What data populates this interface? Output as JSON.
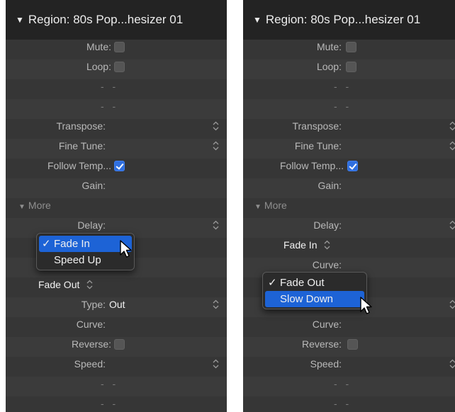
{
  "left": {
    "header": "Region: 80s Pop...hesizer 01",
    "mute": "Mute:",
    "loop": "Loop:",
    "dash1": "- -",
    "dash2": "- -",
    "transpose": "Transpose:",
    "fine_tune": "Fine Tune:",
    "follow_tempo": "Follow Temp...",
    "follow_tempo_checked": true,
    "gain": "Gain:",
    "more": "More",
    "delay": "Delay:",
    "menu": {
      "items": [
        {
          "label": "Fade In",
          "checked": true,
          "highlighted": true
        },
        {
          "label": "Speed Up",
          "checked": false,
          "highlighted": false
        }
      ]
    },
    "check_mark": "✓",
    "fade_out": "Fade Out",
    "type_label": "Type:",
    "type_value": "Out",
    "curve": "Curve:",
    "reverse": "Reverse:",
    "speed": "Speed:",
    "dash3": "- -",
    "dash4": "- -"
  },
  "right": {
    "header": "Region: 80s Pop...hesizer 01",
    "mute": "Mute:",
    "loop": "Loop:",
    "dash1": "- -",
    "dash2": "- -",
    "transpose": "Transpose:",
    "fine_tune": "Fine Tune:",
    "follow_tempo": "Follow Temp...",
    "follow_tempo_checked": true,
    "gain": "Gain:",
    "more": "More",
    "delay": "Delay:",
    "fade_in": "Fade In",
    "curve": "Curve:",
    "menu": {
      "items": [
        {
          "label": "Fade Out",
          "checked": true,
          "highlighted": false
        },
        {
          "label": "Slow Down",
          "checked": false,
          "highlighted": true
        }
      ]
    },
    "check_mark": "✓",
    "curve2": "Curve:",
    "reverse": "Reverse:",
    "speed": "Speed:",
    "dash3": "- -",
    "dash4": "- -"
  },
  "icons": {
    "disclosure": "disclosure-triangle-icon",
    "stepper": "up-down-stepper-icon",
    "cursor": "arrow-cursor-icon"
  },
  "colors": {
    "panel": "#3b3b3b",
    "header": "#232323",
    "highlight": "#1d63d6",
    "checkbox_on": "#2f6fdf"
  }
}
